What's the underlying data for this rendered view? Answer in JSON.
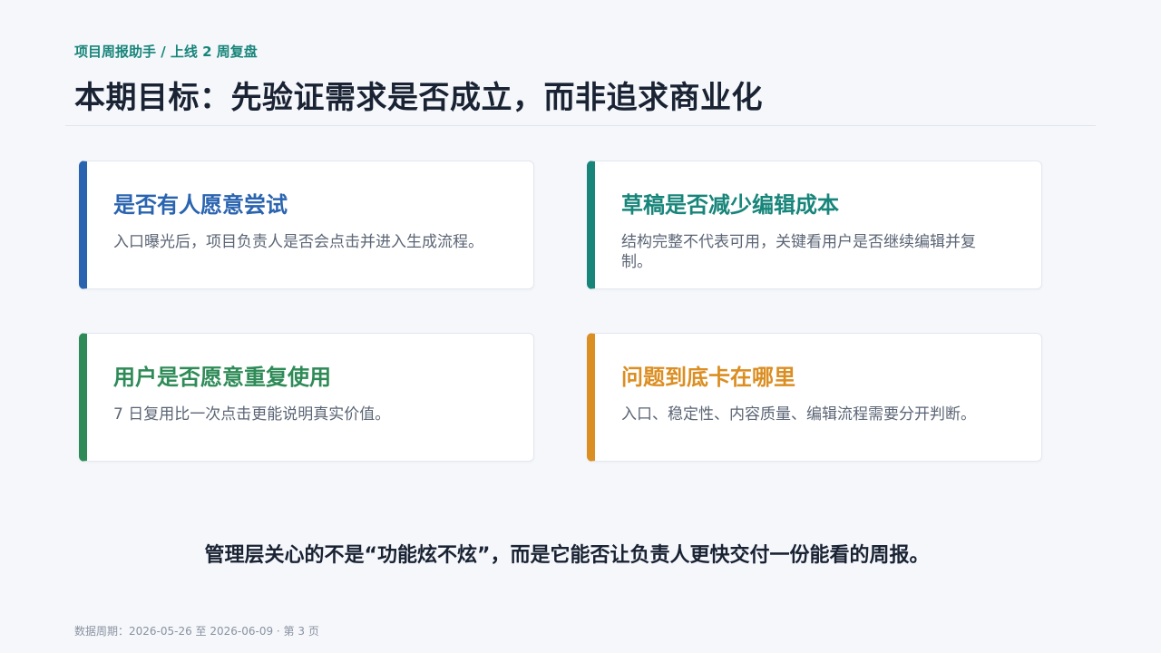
{
  "header": {
    "breadcrumb": "项目周报助手 / 上线 2 周复盘",
    "title": "本期目标：先验证需求是否成立，而非追求商业化"
  },
  "cards": [
    {
      "title": "是否有人愿意尝试",
      "body": "入口曝光后，项目负责人是否会点击并进入生成流程。",
      "accent": "#2a64b0"
    },
    {
      "title": "草稿是否减少编辑成本",
      "body": "结构完整不代表可用，关键看用户是否继续编辑并复制。",
      "accent": "#17857a"
    },
    {
      "title": "用户是否愿意重复使用",
      "body": "7 日复用比一次点击更能说明真实价值。",
      "accent": "#2e8b57"
    },
    {
      "title": "问题到底卡在哪里",
      "body": "入口、稳定性、内容质量、编辑流程需要分开判断。",
      "accent": "#db8e22"
    }
  ],
  "summary": "管理层关心的不是“功能炫不炫”，而是它能否让负责人更快交付一份能看的周报。",
  "footer": "数据周期：2026-05-26 至 2026-06-09 · 第 3 页"
}
